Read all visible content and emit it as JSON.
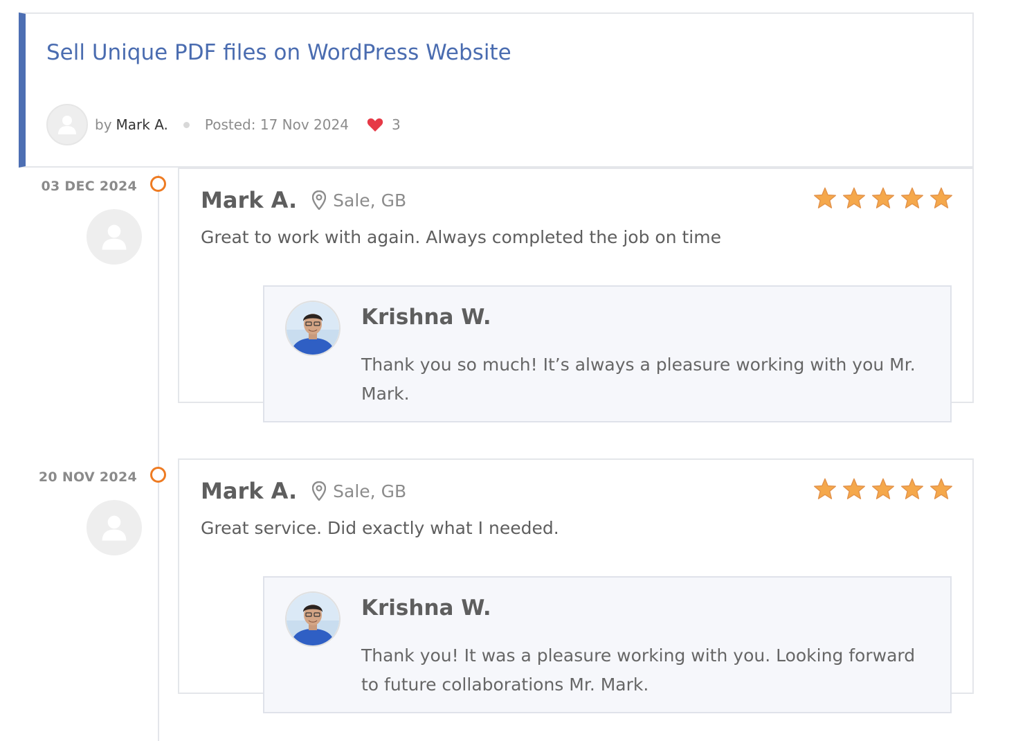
{
  "project": {
    "title": "Sell Unique PDF files on WordPress Website",
    "by_label": "by",
    "author": "Mark A.",
    "posted": "Posted: 17 Nov 2024",
    "likes": "3"
  },
  "colors": {
    "accent": "#4a6cb0",
    "timeline_dot": "#ee7b22",
    "star": "#f5a84b",
    "heart": "#e63946"
  },
  "reviews": [
    {
      "date": "03 DEC 2024",
      "reviewer": "Mark A.",
      "location": "Sale, GB",
      "rating": 5,
      "text": "Great to work with again. Always completed the job on time",
      "reply": {
        "name": "Krishna W.",
        "text": "Thank you so much! It’s always a pleasure working with you Mr. Mark."
      }
    },
    {
      "date": "20 NOV 2024",
      "reviewer": "Mark A.",
      "location": "Sale, GB",
      "rating": 5,
      "text": "Great service. Did exactly what I needed.",
      "reply": {
        "name": "Krishna W.",
        "text": "Thank you! It was a pleasure working with you. Looking forward to future collaborations Mr. Mark."
      }
    }
  ]
}
